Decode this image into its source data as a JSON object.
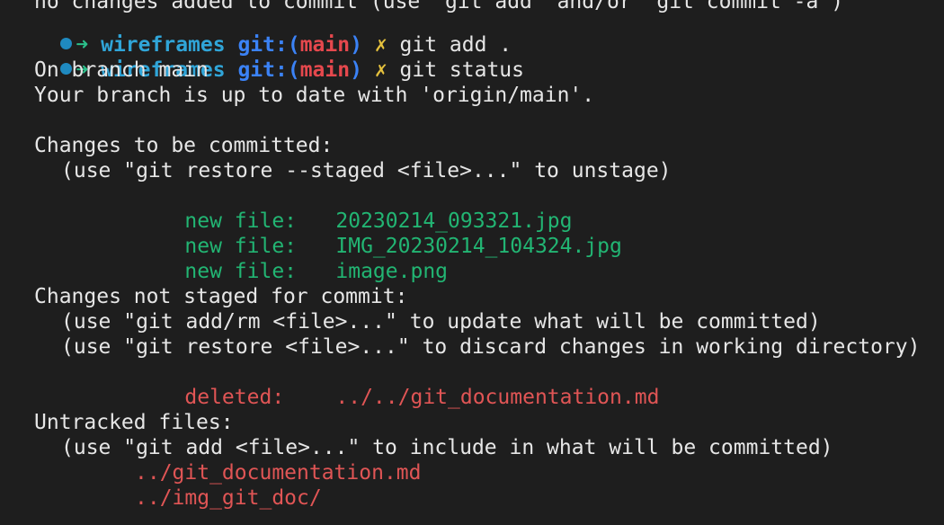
{
  "colors": {
    "background": "#1e1e1e",
    "text": "#e6e6e6",
    "dot": "#1f8ac0",
    "arrow": "#2bbf8a",
    "directory": "#30a5d8",
    "git_label": "#3b82f6",
    "branch": "#e5484d",
    "dirty_mark": "#e5c13d",
    "staged": "#22b573",
    "unstaged": "#e05555"
  },
  "icons": {
    "status_dot": "filled-circle",
    "prompt_arrow": "arrow-right",
    "dirty_mark": "ballot-x"
  },
  "partial_line": "no changes added to commit (use \"git add\" and/or \"git commit -a\")",
  "prompts": [
    {
      "arrow": "➜",
      "directory": "wireframes",
      "git_label": "git:",
      "paren_open": "(",
      "branch": "main",
      "paren_close": ")",
      "dirty_mark": "✗",
      "command": "git add ."
    },
    {
      "arrow": "➜",
      "directory": "wireframes",
      "git_label": "git:",
      "paren_open": "(",
      "branch": "main",
      "paren_close": ")",
      "dirty_mark": "✗",
      "command": "git status"
    }
  ],
  "status": {
    "on_branch": "On branch main",
    "up_to_date": "Your branch is up to date with 'origin/main'.",
    "staged_header": "Changes to be committed:",
    "staged_hint": "(use \"git restore --staged <file>...\" to unstage)",
    "staged_files": [
      {
        "kind": "new file:",
        "path": "20230214_093321.jpg"
      },
      {
        "kind": "new file:",
        "path": "IMG_20230214_104324.jpg"
      },
      {
        "kind": "new file:",
        "path": "image.png"
      }
    ],
    "unstaged_header": "Changes not staged for commit:",
    "unstaged_hint_1": "(use \"git add/rm <file>...\" to update what will be committed)",
    "unstaged_hint_2": "(use \"git restore <file>...\" to discard changes in working directory)",
    "unstaged_files": [
      {
        "kind": "deleted:",
        "path": "../../git_documentation.md"
      }
    ],
    "untracked_header": "Untracked files:",
    "untracked_hint": "(use \"git add <file>...\" to include in what will be committed)",
    "untracked_files": [
      "../git_documentation.md",
      "../img_git_doc/"
    ]
  }
}
